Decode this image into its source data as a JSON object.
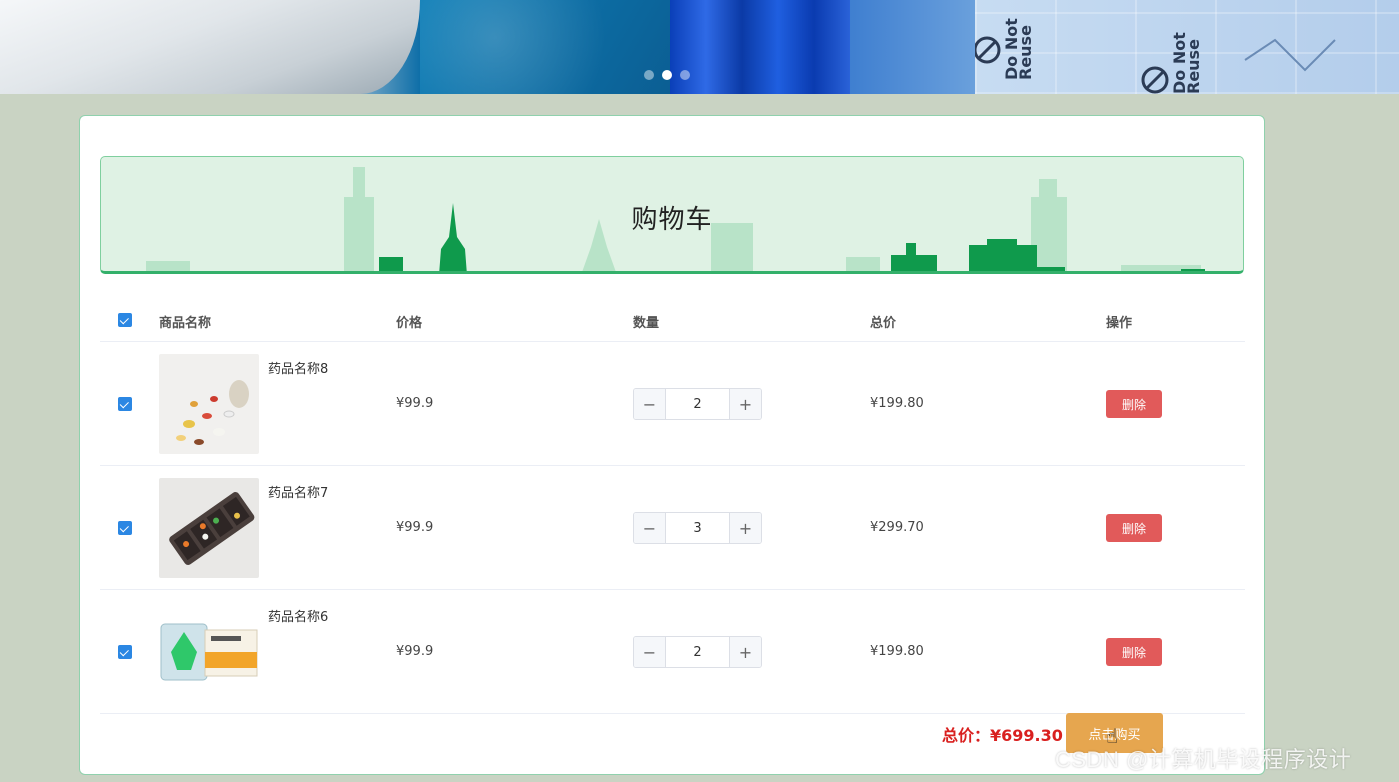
{
  "banner": {
    "slides": 3,
    "active_slide": 2,
    "print_text_1": "Do Not\nReuse",
    "print_text_2": "Do Not\nReuse"
  },
  "cart": {
    "title": "购物车",
    "columns": [
      "商品名称",
      "价格",
      "数量",
      "总价",
      "操作"
    ],
    "items": [
      {
        "name": "药品名称8",
        "price": "¥99.9",
        "qty": "2",
        "total": "¥199.80",
        "delete_label": "删除",
        "checked": true
      },
      {
        "name": "药品名称7",
        "price": "¥99.9",
        "qty": "3",
        "total": "¥299.70",
        "delete_label": "删除",
        "checked": true
      },
      {
        "name": "药品名称6",
        "price": "¥99.9",
        "qty": "2",
        "total": "¥199.80",
        "delete_label": "删除",
        "checked": true
      }
    ],
    "stepper_minus": "−",
    "stepper_plus": "+",
    "grand_total_label": "总价：",
    "grand_total_value": "¥699.30",
    "buy_label": "点击购买"
  },
  "watermark": "CSDN @计算机毕设程序设计",
  "colors": {
    "accent_green": "#33b06a",
    "checkbox_blue": "#2b87e3",
    "delete_red": "#e15a5a",
    "buy_orange": "#e6a64f",
    "total_red": "#d9201f",
    "page_bg": "#c9d3c3"
  }
}
